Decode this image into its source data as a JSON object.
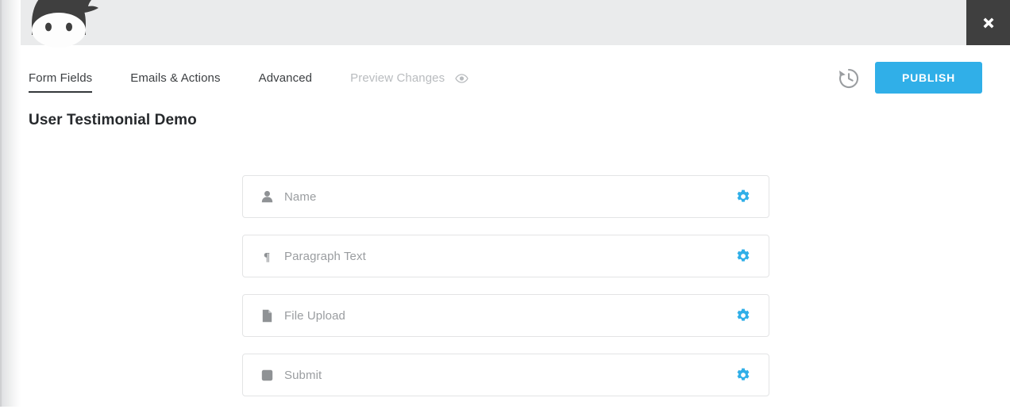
{
  "window": {
    "close_label": "Close",
    "close_icon": "close-x-icon",
    "topbar_color": "#eaebec",
    "close_button_color": "#3f3f3f"
  },
  "brand": {
    "logo_icon": "ninja-forms-logo",
    "logo_color": "#3f3f3f"
  },
  "tabs": [
    {
      "label": "Form Fields",
      "active": true,
      "muted": false,
      "icon": null
    },
    {
      "label": "Emails & Actions",
      "active": false,
      "muted": false,
      "icon": null
    },
    {
      "label": "Advanced",
      "active": false,
      "muted": false,
      "icon": null
    },
    {
      "label": "Preview Changes",
      "active": false,
      "muted": true,
      "icon": "eye-icon"
    }
  ],
  "actions": {
    "history_icon": "history-restore-icon",
    "history_label": "Form History",
    "publish_label": "PUBLISH",
    "publish_color": "#30afe8"
  },
  "form": {
    "title": "User Testimonial Demo",
    "fields": [
      {
        "label": "Name",
        "icon": "user-icon",
        "settings_icon": "gear-icon"
      },
      {
        "label": "Paragraph Text",
        "icon": "pilcrow-icon",
        "settings_icon": "gear-icon"
      },
      {
        "label": "File Upload",
        "icon": "document-icon",
        "settings_icon": "gear-icon"
      },
      {
        "label": "Submit",
        "icon": "button-icon",
        "settings_icon": "gear-icon"
      }
    ]
  },
  "colors": {
    "accent": "#30afe8",
    "icon_gray": "#8f9295",
    "label_gray": "#9a9da0",
    "border": "#e3e4e5",
    "text_dark": "#26292c"
  }
}
